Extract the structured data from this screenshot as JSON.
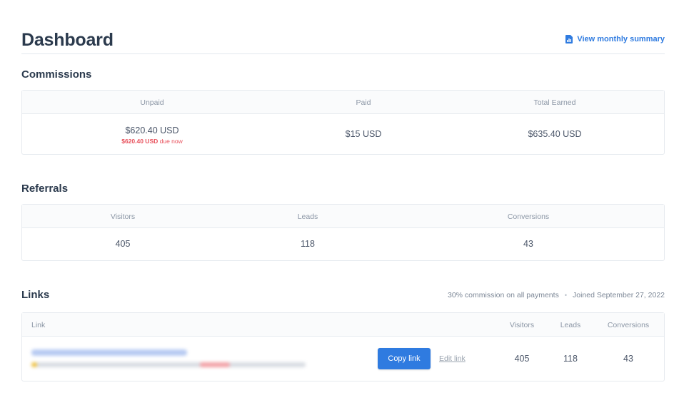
{
  "header": {
    "title": "Dashboard",
    "summary_link": "View monthly summary",
    "summary_icon": "report-icon"
  },
  "commissions": {
    "title": "Commissions",
    "columns": [
      "Unpaid",
      "Paid",
      "Total Earned"
    ],
    "unpaid": "$620.40 USD",
    "due_amount": "$620.40 USD",
    "due_suffix": "due now",
    "paid": "$15 USD",
    "total": "$635.40 USD"
  },
  "referrals": {
    "title": "Referrals",
    "columns": [
      "Visitors",
      "Leads",
      "Conversions"
    ],
    "values": [
      "405",
      "118",
      "43"
    ]
  },
  "links": {
    "title": "Links",
    "commission_note": "30% commission on all payments",
    "separator": "•",
    "joined": "Joined September 27, 2022",
    "columns": [
      "Link",
      "Visitors",
      "Leads",
      "Conversions"
    ],
    "row": {
      "copy_label": "Copy link",
      "edit_label": "Edit link",
      "visitors": "405",
      "leads": "118",
      "conversions": "43"
    }
  },
  "colors": {
    "accent": "#2f7be0",
    "due": "#e8505b",
    "heading": "#2b3a4d"
  }
}
